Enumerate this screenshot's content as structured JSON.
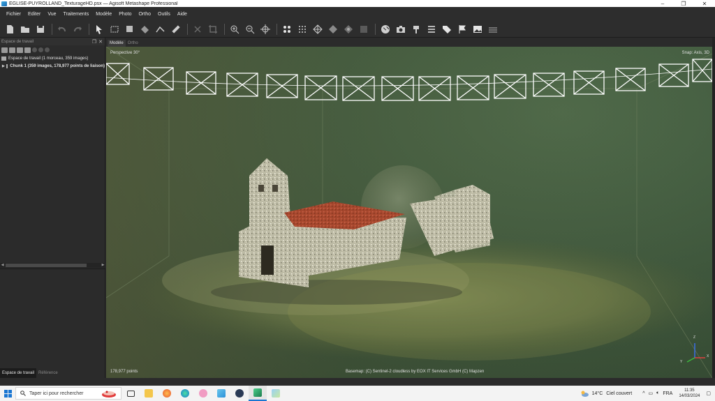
{
  "window": {
    "title": "EGLISE-PUYROLLAND_TexturageHD.psx — Agisoft Metashape Professional",
    "controls": [
      "–",
      "❐",
      "✕"
    ]
  },
  "menu": [
    "Fichier",
    "Editer",
    "Vue",
    "Traitements",
    "Modèle",
    "Photo",
    "Ortho",
    "Outils",
    "Aide"
  ],
  "workspace": {
    "header": "Espace de travail",
    "root": "Espace de travail (1 morceau, 359 images)",
    "chunk": "Chunk 1 (359 images, 178,977 points de liaison)",
    "tabs": [
      "Espace de travail",
      "Référence"
    ]
  },
  "viewport": {
    "tabs": [
      "Modèle",
      "Ortho"
    ],
    "perspective": "Perspective 30°",
    "snap": "Snap: Axis, 3D",
    "points": "178,977 points",
    "basemap": "Basemap: (C) Sentinel-2 cloudless by EOX IT Services GmbH (C) Mapzen",
    "axes": {
      "x": "X",
      "y": "Y",
      "z": "Z"
    }
  },
  "taskbar": {
    "search_placeholder": "Taper ici pour rechercher",
    "weather_temp": "14°C",
    "weather_text": "Ciel couvert",
    "language": "FRA",
    "time": "11:35",
    "date": "14/03/2024"
  },
  "colors": {
    "accent": "#1976d2",
    "roof": "#a8482e",
    "sparse_points": "#d9d4b8"
  }
}
